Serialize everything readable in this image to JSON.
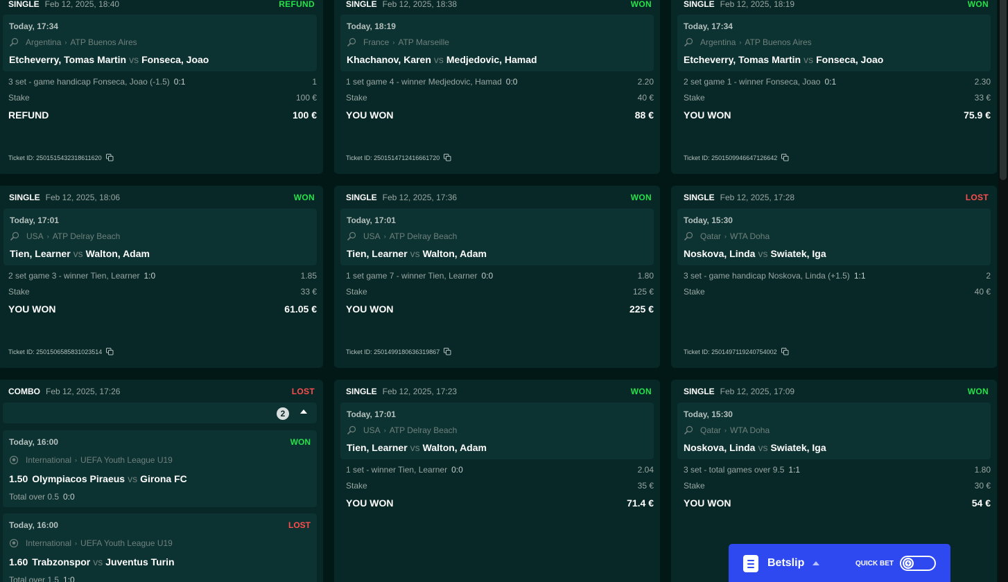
{
  "tickets": [
    {
      "type": "SINGLE",
      "date": "Feb 12, 2025, 18:40",
      "status": "REFUND",
      "time": "Today, 17:34",
      "country": "Argentina",
      "league": "ATP Buenos Aires",
      "home": "Etcheverry, Tomas Martin",
      "vs": "vs",
      "away": "Fonseca, Joao",
      "pick": "3 set - game handicap Fonseca, Joao (-1.5)",
      "score": "0:1",
      "odds": "1",
      "stake_label": "Stake",
      "stake": "100 €",
      "result_label": "REFUND",
      "result_value": "100 €",
      "ticket_id": "Ticket ID: 2501515432318611620"
    },
    {
      "type": "SINGLE",
      "date": "Feb 12, 2025, 18:38",
      "status": "WON",
      "time": "Today, 18:19",
      "country": "France",
      "league": "ATP Marseille",
      "home": "Khachanov, Karen",
      "vs": "vs",
      "away": "Medjedovic, Hamad",
      "pick": "1 set game 4 - winner Medjedovic, Hamad",
      "score": "0:0",
      "odds": "2.20",
      "stake_label": "Stake",
      "stake": "40 €",
      "result_label": "YOU WON",
      "result_value": "88 €",
      "ticket_id": "Ticket ID: 2501514712416661720"
    },
    {
      "type": "SINGLE",
      "date": "Feb 12, 2025, 18:19",
      "status": "WON",
      "time": "Today, 17:34",
      "country": "Argentina",
      "league": "ATP Buenos Aires",
      "home": "Etcheverry, Tomas Martin",
      "vs": "vs",
      "away": "Fonseca, Joao",
      "pick": "2 set game 1 - winner Fonseca, Joao",
      "score": "0:1",
      "odds": "2.30",
      "stake_label": "Stake",
      "stake": "33 €",
      "result_label": "YOU WON",
      "result_value": "75.9 €",
      "ticket_id": "Ticket ID: 2501509946647126642"
    },
    {
      "type": "SINGLE",
      "date": "Feb 12, 2025, 18:06",
      "status": "WON",
      "time": "Today, 17:01",
      "country": "USA",
      "league": "ATP Delray Beach",
      "home": "Tien, Learner",
      "vs": "vs",
      "away": "Walton, Adam",
      "pick": "2 set game 3 - winner Tien, Learner",
      "score": "1:0",
      "odds": "1.85",
      "stake_label": "Stake",
      "stake": "33 €",
      "result_label": "YOU WON",
      "result_value": "61.05 €",
      "ticket_id": "Ticket ID: 2501506585831023514"
    },
    {
      "type": "SINGLE",
      "date": "Feb 12, 2025, 17:36",
      "status": "WON",
      "time": "Today, 17:01",
      "country": "USA",
      "league": "ATP Delray Beach",
      "home": "Tien, Learner",
      "vs": "vs",
      "away": "Walton, Adam",
      "pick": "1 set game 7 - winner Tien, Learner",
      "score": "0:0",
      "odds": "1.80",
      "stake_label": "Stake",
      "stake": "125 €",
      "result_label": "YOU WON",
      "result_value": "225 €",
      "ticket_id": "Ticket ID: 2501499180636319867"
    },
    {
      "type": "SINGLE",
      "date": "Feb 12, 2025, 17:28",
      "status": "LOST",
      "time": "Today, 15:30",
      "country": "Qatar",
      "league": "WTA Doha",
      "home": "Noskova, Linda",
      "vs": "vs",
      "away": "Swiatek, Iga",
      "pick": "3 set - game handicap Noskova, Linda (+1.5)",
      "score": "1:1",
      "odds": "2",
      "stake_label": "Stake",
      "stake": "40 €",
      "ticket_id": "Ticket ID: 2501497119240754002"
    },
    {
      "type": "SINGLE",
      "date": "Feb 12, 2025, 17:23",
      "status": "WON",
      "time": "Today, 17:01",
      "country": "USA",
      "league": "ATP Delray Beach",
      "home": "Tien, Learner",
      "vs": "vs",
      "away": "Walton, Adam",
      "pick": "1 set - winner Tien, Learner",
      "score": "0:0",
      "odds": "2.04",
      "stake_label": "Stake",
      "stake": "35 €",
      "result_label": "YOU WON",
      "result_value": "71.4 €"
    },
    {
      "type": "SINGLE",
      "date": "Feb 12, 2025, 17:09",
      "status": "WON",
      "time": "Today, 15:30",
      "country": "Qatar",
      "league": "WTA Doha",
      "home": "Noskova, Linda",
      "vs": "vs",
      "away": "Swiatek, Iga",
      "pick": "3 set - total games over 9.5",
      "score": "1:1",
      "odds": "1.80",
      "stake_label": "Stake",
      "stake": "30 €",
      "result_label": "YOU WON",
      "result_value": "54 €"
    }
  ],
  "combo": {
    "type": "COMBO",
    "date": "Feb 12, 2025, 17:26",
    "status": "LOST",
    "count": "2",
    "legs": [
      {
        "time": "Today, 16:00",
        "status": "WON",
        "country": "International",
        "league": "UEFA Youth League U19",
        "odds": "1.50",
        "home": "Olympiacos Piraeus",
        "vs": "vs",
        "away": "Girona FC",
        "pick": "Total over 0.5",
        "score": "0:0"
      },
      {
        "time": "Today, 16:00",
        "status": "LOST",
        "country": "International",
        "league": "UEFA Youth League U19",
        "odds": "1.60",
        "home": "Trabzonspor",
        "vs": "vs",
        "away": "Juventus Turin",
        "pick": "Total over 1.5",
        "score": "1:0"
      }
    ]
  },
  "betslip": {
    "title": "Betslip",
    "quick_bet_label": "QUICK BET"
  },
  "colors": {
    "background": "#021816",
    "card": "#072826",
    "event": "#0c3331",
    "won": "#27e04a",
    "lost": "#ff4d4d",
    "betslip": "#2f49f0"
  },
  "icons": {
    "tennis": "tennis-icon",
    "football": "football-icon",
    "copy": "copy-icon",
    "betslip": "betslip-icon",
    "lightning": "lightning-icon"
  }
}
